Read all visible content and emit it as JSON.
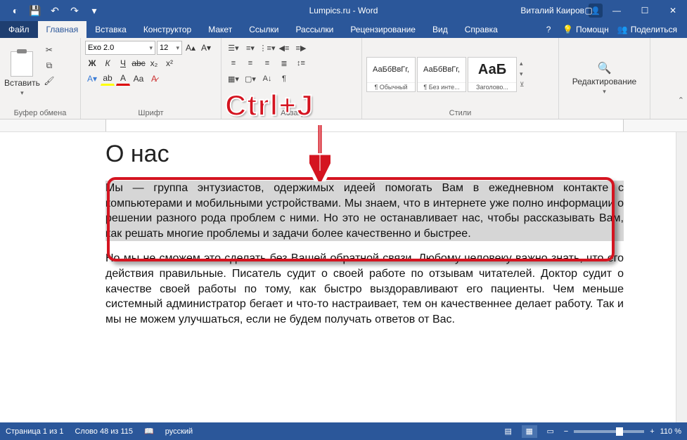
{
  "titlebar": {
    "title": "Lumpics.ru - Word",
    "user_name": "Виталий Каиров",
    "avatar_glyph": "👤"
  },
  "tabs": {
    "file": "Файл",
    "home": "Главная",
    "insert": "Вставка",
    "design": "Конструктор",
    "layout": "Макет",
    "references": "Ссылки",
    "mailings": "Рассылки",
    "review": "Рецензирование",
    "view": "Вид",
    "help": "Справка",
    "tell_me": "Помощн",
    "share": "Поделиться"
  },
  "ribbon": {
    "clipboard": {
      "group": "Буфер обмена",
      "paste": "Вставить"
    },
    "font": {
      "group": "Шрифт",
      "name": "Exo 2.0",
      "size": "12",
      "bold": "Ж",
      "italic": "К",
      "under": "Ч",
      "strike": "abc",
      "sub": "x₂",
      "sup": "x²",
      "clear": "A",
      "caps": "Aa"
    },
    "para": {
      "group": "Абзац"
    },
    "styles": {
      "group": "Стили",
      "preview1": "АаБбВвГг,",
      "name1": "¶ Обычный",
      "preview2": "АаБбВвГг,",
      "name2": "¶ Без инте...",
      "preview3": "АаБ",
      "name3": "Заголово..."
    },
    "edit": {
      "group": "",
      "label": "Редактирование"
    }
  },
  "document": {
    "heading": "О нас",
    "para1": "Мы — группа энтузиастов, одержимых идеей помогать Вам в ежедневном контакте с компьютерами и мобильными устройствами. Мы знаем, что в интернете уже полно информации о решении разного рода проблем с ними. Но это не останавливает нас, чтобы рассказывать Вам, как решать многие проблемы и задачи более качественно и быстрее.",
    "para2": "Но мы не сможем это сделать без Вашей обратной связи. Любому человеку важно знать, что его действия правильные. Писатель судит о своей работе по отзывам читателей. Доктор судит о качестве своей работы по тому, как быстро выздоравливают его пациенты. Чем меньше системный администратор бегает и что-то настраивает, тем он качественнее делает работу. Так и мы не можем улучшаться, если не будем получать ответов от Вас."
  },
  "annotation": {
    "label": "Ctrl+J"
  },
  "status": {
    "page": "Страница 1 из 1",
    "words": "Слово 48 из 115",
    "lang": "русский",
    "zoom": "110 %"
  }
}
